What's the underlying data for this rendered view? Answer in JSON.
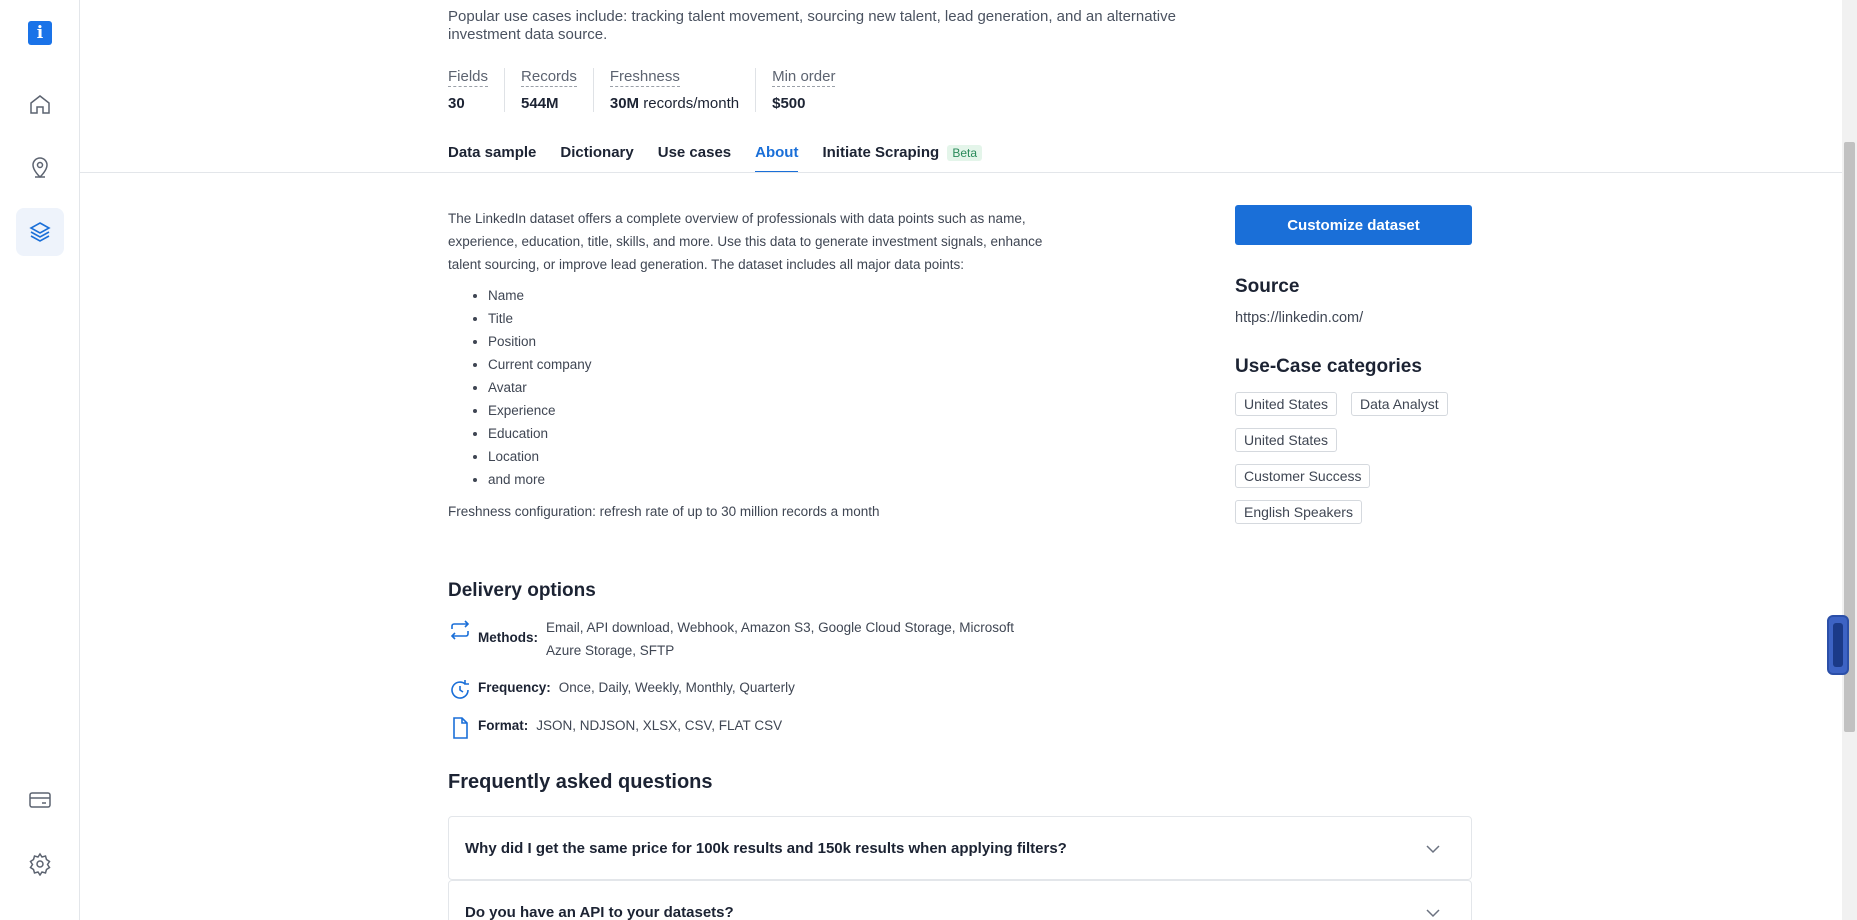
{
  "sidebar": {
    "logo_letter": "i",
    "items": [
      {
        "name": "home"
      },
      {
        "name": "location"
      },
      {
        "name": "datasets"
      },
      {
        "name": "billing"
      },
      {
        "name": "settings"
      }
    ]
  },
  "intro": {
    "text": "Popular use cases include: tracking talent movement, sourcing new talent, lead generation, and an alternative investment data source."
  },
  "stats": [
    {
      "label": "Fields",
      "value": "30",
      "suffix": ""
    },
    {
      "label": "Records",
      "value": "544M",
      "suffix": ""
    },
    {
      "label": "Freshness",
      "value": "30M",
      "suffix": " records/month"
    },
    {
      "label": "Min order",
      "value": "$500",
      "suffix": ""
    }
  ],
  "tabs": {
    "data_sample": "Data sample",
    "dictionary": "Dictionary",
    "use_cases": "Use cases",
    "about": "About",
    "initiate_scraping": "Initiate Scraping",
    "beta": "Beta",
    "active": "About"
  },
  "about": {
    "paragraph": "The LinkedIn dataset offers a complete overview of professionals with data points such as name, experience, education, title, skills, and more. Use this data to generate investment signals, enhance talent sourcing, or improve lead generation. The dataset includes all major data points:",
    "points": [
      "Name",
      "Title",
      "Position",
      "Current company",
      "Avatar",
      "Experience",
      "Education",
      "Location",
      "and more"
    ],
    "freshness": "Freshness configuration: refresh rate of up to 30 million records a month"
  },
  "right_panel": {
    "customize_label": "Customize dataset",
    "source_heading": "Source",
    "source_url": "https://linkedin.com/",
    "categories_heading": "Use-Case categories",
    "categories": [
      "United States",
      "Data Analyst",
      "United States",
      "Customer Success",
      "English Speakers"
    ]
  },
  "delivery": {
    "heading": "Delivery options",
    "methods_label": "Methods:",
    "methods_value": "Email, API download, Webhook, Amazon S3, Google Cloud Storage, Microsoft Azure Storage, SFTP",
    "frequency_label": "Frequency:",
    "frequency_value": "Once, Daily, Weekly, Monthly, Quarterly",
    "format_label": "Format:",
    "format_value": "JSON, NDJSON, XLSX, CSV, FLAT CSV"
  },
  "faq": {
    "heading": "Frequently asked questions",
    "questions": [
      "Why did I get the same price for 100k results and 150k results when applying filters?",
      "Do you have an API to your datasets?"
    ]
  },
  "colors": {
    "accent": "#1a6fd8",
    "beta_text": "#2a8a5a",
    "beta_bg": "#e4f5ea"
  }
}
